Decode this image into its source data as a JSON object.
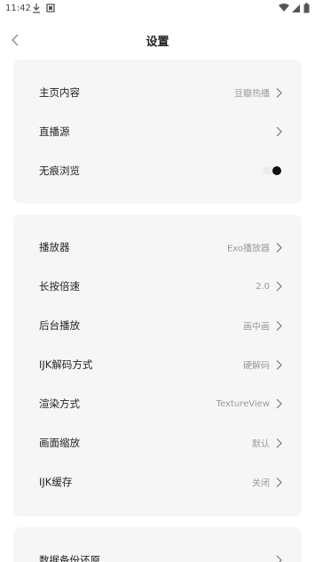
{
  "status_bar": {
    "time": "11:42",
    "left_icons": [
      "download-icon",
      "notification-icon"
    ],
    "right_icons": [
      "wifi-icon",
      "signal-icon",
      "battery-icon"
    ]
  },
  "header": {
    "title": "设置",
    "back_icon": "chevron-left-icon"
  },
  "section1": {
    "items": [
      {
        "label": "主页内容",
        "value": "豆瓣热播"
      },
      {
        "label": "直播源",
        "value": ""
      },
      {
        "label": "无痕浏览",
        "toggle": false
      }
    ]
  },
  "section2": {
    "items": [
      {
        "label": "播放器",
        "value": "Exo播放器"
      },
      {
        "label": "长按倍速",
        "value": "2.0"
      },
      {
        "label": "后台播放",
        "value": "画中画"
      },
      {
        "label": "IJK解码方式",
        "value": "硬解码"
      },
      {
        "label": "渲染方式",
        "value": "TextureView"
      },
      {
        "label": "画面缩放",
        "value": "默认"
      },
      {
        "label": "IJK缓存",
        "value": "关闭"
      }
    ]
  },
  "section3": {
    "items": [
      {
        "label": "数据备份还原",
        "value": ""
      }
    ]
  },
  "colors": {
    "card_bg": "#f6f6f6",
    "value_text": "#9a9a9a",
    "label_text": "#222222"
  }
}
